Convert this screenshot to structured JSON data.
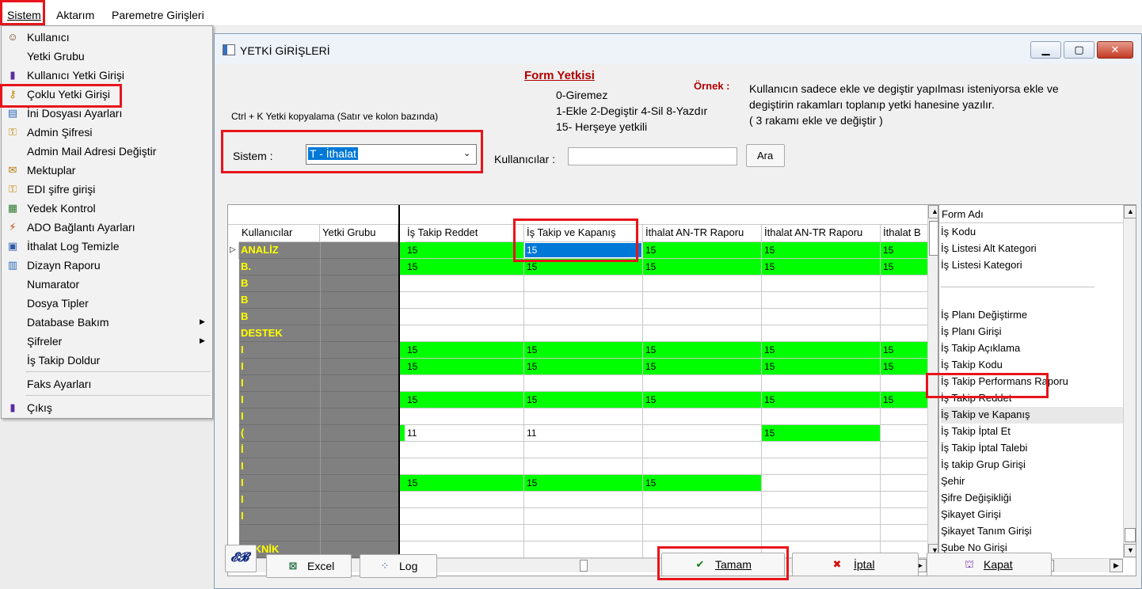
{
  "menubar": {
    "items": [
      "Sistem",
      "Aktarım",
      "Paremetre Girişleri"
    ]
  },
  "menu": {
    "items": [
      {
        "label": "Kullanıcı",
        "icon": "user-icon"
      },
      {
        "label": "Yetki Grubu",
        "icon": ""
      },
      {
        "label": "Kullanıcı Yetki Girişi",
        "icon": "lock-icon"
      },
      {
        "label": "Çoklu Yetki Girişi",
        "icon": "multi-key-icon"
      },
      {
        "label": "İni Dosyası  Ayarları",
        "icon": "ini-file-icon"
      },
      {
        "label": "Admin Şifresi",
        "icon": "key-icon"
      },
      {
        "label": "Admin Mail Adresi Değiştir",
        "icon": ""
      },
      {
        "label": "Mektuplar",
        "icon": "letter-icon"
      },
      {
        "label": "EDI şifre girişi",
        "icon": "key-icon"
      },
      {
        "label": "Yedek Kontrol",
        "icon": "backup-icon"
      },
      {
        "label": "ADO Bağlantı Ayarları",
        "icon": "connection-icon"
      },
      {
        "label": "İthalat Log Temizle",
        "icon": "log-icon"
      },
      {
        "label": "Dizayn Raporu",
        "icon": "report-icon"
      },
      {
        "label": "Numarator",
        "icon": ""
      },
      {
        "label": "Dosya Tipler",
        "icon": ""
      },
      {
        "label": "Database Bakım",
        "icon": "",
        "submenu": true
      },
      {
        "label": "Şifreler",
        "icon": "",
        "submenu": true
      },
      {
        "label": "İş Takip Doldur",
        "icon": ""
      },
      {
        "label": "Faks Ayarları",
        "icon": ""
      },
      {
        "label": "Çıkış",
        "icon": "exit-icon"
      }
    ]
  },
  "window": {
    "title": "YETKİ GİRİŞLERİ",
    "form_yetkisi": "Form Yetkisi",
    "ornek_label": "Örnek :",
    "legend": [
      "0-Giremez",
      "1-Ekle  2-Degiştir  4-Sil  8-Yazdır",
      "15- Herşeye yetkili"
    ],
    "example_text": [
      "Kullanıcın sadece ekle ve degiştir yapılması isteniyorsa  ekle ve",
      "degiştirin rakamları toplanıp yetki hanesine yazılır.",
      " ( 3 rakamı ekle ve değiştir )"
    ],
    "copy_hint": "Ctrl + K Yetki kopyalama (Satır ve kolon bazında)",
    "sistem_label": "Sistem :",
    "sistem_value": "T - İthalat",
    "kullanicilar_label": "Kullanıcılar :",
    "kullanicilar_value": "",
    "ara_button": "Ara"
  },
  "grid": {
    "user_headers": [
      "Kullanıcılar",
      "Yetki Grubu"
    ],
    "columns": [
      "İş Takip Reddet",
      "İş Takip ve Kapanış",
      "İthalat AN-TR Raporu",
      "İthalat AN-TR Raporu",
      "İthalat B"
    ],
    "rows": [
      {
        "user": "ANALİZ",
        "values": [
          "15",
          "15",
          "15",
          "15",
          "15"
        ],
        "green": [
          true,
          false,
          true,
          true,
          true
        ]
      },
      {
        "user": "B.",
        "values": [
          "15",
          "15",
          "15",
          "15",
          "15"
        ],
        "green": [
          true,
          true,
          true,
          true,
          true
        ]
      },
      {
        "user": "B",
        "values": [
          "",
          "",
          "",
          "",
          ""
        ],
        "green": [
          false,
          false,
          false,
          false,
          false
        ]
      },
      {
        "user": "B",
        "values": [
          "",
          "",
          "",
          "",
          ""
        ],
        "green": [
          false,
          false,
          false,
          false,
          false
        ]
      },
      {
        "user": "B",
        "values": [
          "",
          "",
          "",
          "",
          ""
        ],
        "green": [
          false,
          false,
          false,
          false,
          false
        ]
      },
      {
        "user": "DESTEK",
        "values": [
          "",
          "",
          "",
          "",
          ""
        ],
        "green": [
          false,
          false,
          false,
          false,
          false
        ]
      },
      {
        "user": "I",
        "values": [
          "15",
          "15",
          "15",
          "15",
          "15"
        ],
        "green": [
          true,
          true,
          true,
          true,
          true
        ]
      },
      {
        "user": "I",
        "values": [
          "15",
          "15",
          "15",
          "15",
          "15"
        ],
        "green": [
          true,
          true,
          true,
          true,
          true
        ]
      },
      {
        "user": "I",
        "values": [
          "",
          "",
          "",
          "",
          ""
        ],
        "green": [
          false,
          false,
          false,
          false,
          false
        ]
      },
      {
        "user": "I",
        "values": [
          "15",
          "15",
          "15",
          "15",
          "15"
        ],
        "green": [
          true,
          true,
          true,
          true,
          true
        ]
      },
      {
        "user": "I",
        "values": [
          "",
          "",
          "",
          "",
          ""
        ],
        "green": [
          false,
          false,
          false,
          false,
          false
        ]
      },
      {
        "user": "(",
        "values": [
          "11",
          "11",
          "",
          "15",
          ""
        ],
        "green": [
          false,
          false,
          false,
          true,
          false
        ]
      },
      {
        "user": "İ",
        "values": [
          "",
          "",
          "",
          "",
          ""
        ],
        "green": [
          false,
          false,
          false,
          false,
          false
        ]
      },
      {
        "user": "I",
        "values": [
          "",
          "",
          "",
          "",
          ""
        ],
        "green": [
          false,
          false,
          false,
          false,
          false
        ]
      },
      {
        "user": "I",
        "values": [
          "15",
          "15",
          "15",
          "",
          ""
        ],
        "green": [
          true,
          true,
          true,
          false,
          false
        ]
      },
      {
        "user": "I",
        "values": [
          "",
          "",
          "",
          "",
          ""
        ],
        "green": [
          false,
          false,
          false,
          false,
          false
        ]
      },
      {
        "user": "I",
        "values": [
          "",
          "",
          "",
          "",
          ""
        ],
        "green": [
          false,
          false,
          false,
          false,
          false
        ]
      },
      {
        "user": "",
        "values": [
          "",
          "",
          "",
          "",
          ""
        ],
        "green": [
          false,
          false,
          false,
          false,
          false
        ]
      },
      {
        "user": "TEKNİK",
        "values": [
          "",
          "",
          "",
          "",
          ""
        ],
        "green": [
          false,
          false,
          false,
          false,
          false
        ]
      }
    ]
  },
  "form_list": {
    "header": "Form Adı",
    "items": [
      "İş Kodu",
      "İş Listesi Alt Kategori",
      "İş Listesi Kategori",
      "",
      "",
      "İş Planı Değiştirme",
      "İş Planı Girişi",
      "İş Takip Açıklama",
      "İş Takip Kodu",
      "İş Takip Performans Raporu",
      "İş Takip Reddet",
      "İş Takip ve Kapanış",
      "İş Takip İptal Et",
      "İş Takip İptal Talebi",
      "İş takip Grup Girişi",
      "Şehir",
      "Şifre Değişikliği",
      "Şikayet Girişi",
      "Şikayet Tanım Girişi",
      "Şube No Girişi"
    ]
  },
  "buttons": {
    "excel": "Excel",
    "log": "Log",
    "tamam": "Tamam",
    "iptal": "İptal",
    "kapat": "Kapat"
  },
  "colors": {
    "highlight": "#e8141b",
    "granted": "#00ff00",
    "selection": "#0078d7",
    "user_text": "#ffff00"
  }
}
